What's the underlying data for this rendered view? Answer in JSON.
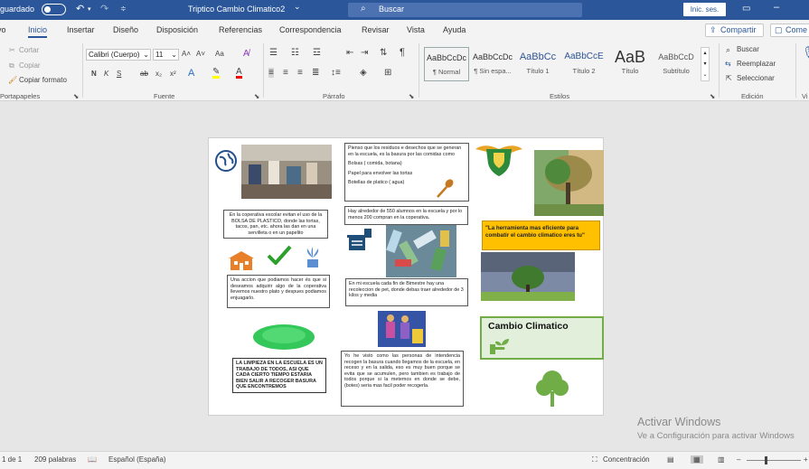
{
  "titlebar": {
    "autosave_label": "guardado",
    "doc_title": "Triptico Cambio Climatico2",
    "title_caret": "⌄",
    "search_placeholder": "Buscar",
    "signin_label": "Inic. ses.",
    "minimize_glyph": "–",
    "accent": "#2b579a"
  },
  "tabs": [
    "vo",
    "Inicio",
    "Insertar",
    "Diseño",
    "Disposición",
    "Referencias",
    "Correspondencia",
    "Revisar",
    "Vista",
    "Ayuda"
  ],
  "share_label": "Compartir",
  "comments_label": "Come",
  "clipboard": {
    "cut": "Cortar",
    "copy": "Copiar",
    "format": "Copiar formato",
    "group": "Portapapeles"
  },
  "font": {
    "name": "Calibri (Cuerpo)",
    "size": "11",
    "grow": "A˄",
    "shrink": "A˅",
    "case": "Aa",
    "bold": "N",
    "italic": "K",
    "underline": "S",
    "strike": "ab",
    "sub": "x₂",
    "sup": "x²",
    "group": "Fuente"
  },
  "paragraph": {
    "group": "Párrafo"
  },
  "styles": {
    "items": [
      {
        "preview": "AaBbCcDc",
        "name": "¶ Normal"
      },
      {
        "preview": "AaBbCcDc",
        "name": "¶ Sin espa..."
      },
      {
        "preview": "AaBbCc",
        "name": "Título 1"
      },
      {
        "preview": "AaBbCcE",
        "name": "Título 2"
      },
      {
        "preview": "AaB",
        "name": "Título"
      },
      {
        "preview": "AaBbCcD",
        "name": "Subtítulo"
      }
    ],
    "group": "Estilos"
  },
  "editing": {
    "find": "Buscar",
    "replace": "Reemplazar",
    "select": "Seleccionar",
    "group": "Edición",
    "extra": "Vi"
  },
  "document": {
    "p1_text1": "En la coperativa escolar evitan el uso de la BOLSA DE PLASTICO, donde las tortas, tacos, pan, etc. ahora las dan en una servilleta o en un papelito",
    "p1_text2": "Una accion que podiamos hacer és que si deseamos adquirir algo de la coperativa llevemos nuestro plato y despues podiamos enjuagarlo.",
    "p1_text3": "LA LIMPIEZA EN LA ESCUELA ES UN TRABAJO DE TODOS, ASI QUE CADA CIERTO TIEMPO ESTARIA BIEN SALIR A RECOGER BASURA QUE ENCONTREMOS",
    "p2_intro": "Pienso que los residuos e desechos que se generan en la escuela, es la basura por las comidas como",
    "p2_items": [
      "Bolsas ( comida, botana)",
      "Papel para envolver las tortas",
      "Botellas de platico ( agua)"
    ],
    "p2_text2": "Hay alrededor de 550 alumnos en la escuela y por lo menos 200 compran en la coperativa.",
    "p2_text3": "En mi escuela cada fin de Bimestre hay una recoleccion de pet, donde debas traer alrededor de 3 kilos y media",
    "p2_text4": "Yo he visto como las personas de intendencia recogen la basura cuando llegamos de la escuela, en receso y en la salida, eso es muy buen porque se evita que se acumulen, pero tambien es trabajo de todos porque si la metemos en donde se debe, (botes) seria mas facil poder recogerla.",
    "p3_quote": "\"La herramienta mas eficiente para combatir el cambio climatico eres tu\"",
    "p3_title": "Cambio Climatico"
  },
  "watermark": {
    "line1": "Activar Windows",
    "line2": "Ve a Configuración para activar Windows"
  },
  "status": {
    "page": "1 de 1",
    "words": "209 palabras",
    "language": "Español (España)",
    "focus": "Concentración"
  }
}
